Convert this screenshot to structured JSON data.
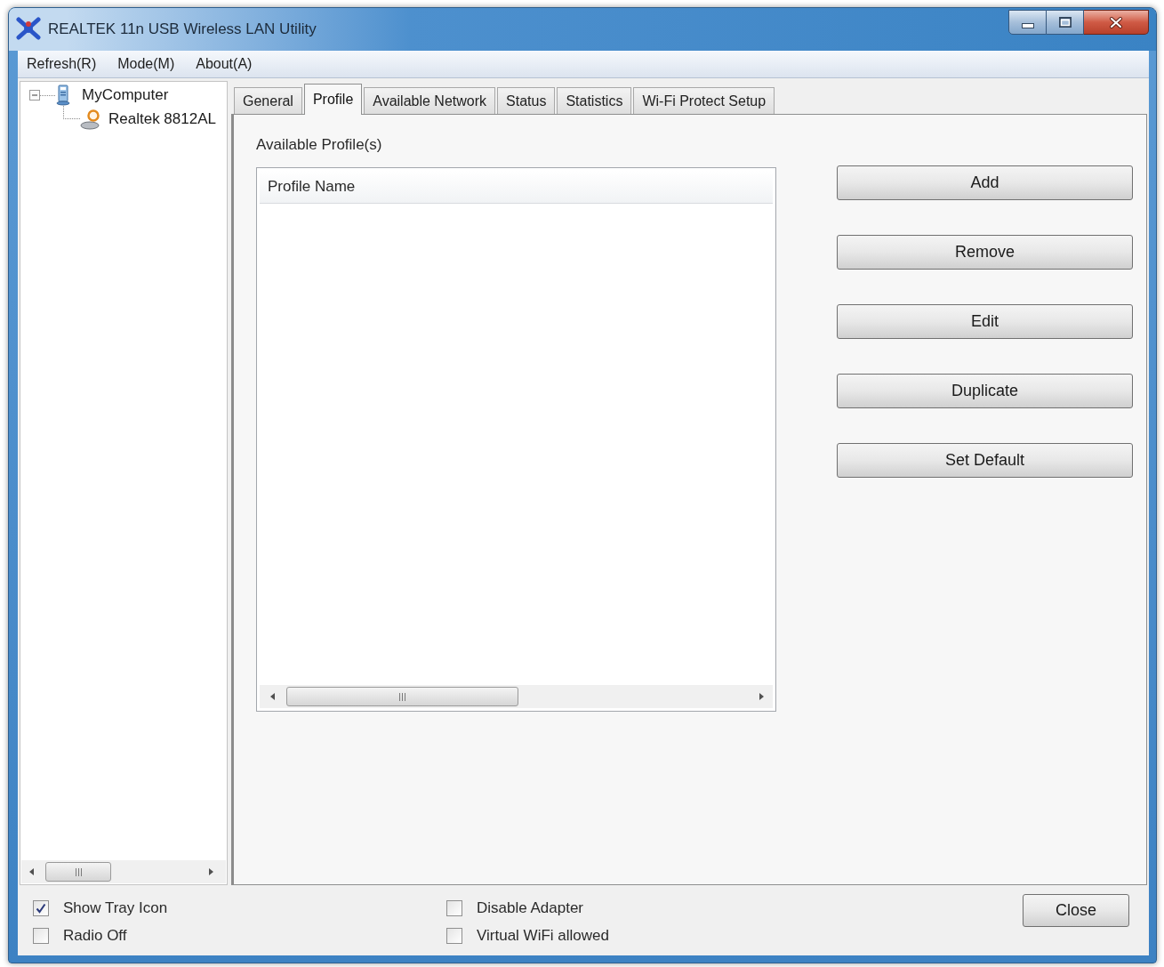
{
  "window": {
    "title": "REALTEK 11n USB Wireless LAN Utility"
  },
  "menu_bar": [
    {
      "label": "Refresh(R)"
    },
    {
      "label": "Mode(M)"
    },
    {
      "label": "About(A)"
    }
  ],
  "tree": [
    {
      "label": "MyComputer",
      "kind": "computer",
      "expanded": true,
      "children": [
        {
          "label": "Realtek 8812AL",
          "kind": "adapter"
        }
      ]
    }
  ],
  "tabs": [
    {
      "label": "General",
      "selected": false
    },
    {
      "label": "Profile",
      "selected": true
    },
    {
      "label": "Available Network",
      "selected": false
    },
    {
      "label": "Status",
      "selected": false
    },
    {
      "label": "Statistics",
      "selected": false
    },
    {
      "label": "Wi-Fi Protect Setup",
      "selected": false
    }
  ],
  "profile_tab": {
    "heading": "Available Profile(s)",
    "profile_list": {
      "columns": [
        "Profile Name"
      ]
    },
    "buttons": [
      "Add",
      "Remove",
      "Edit",
      "Duplicate",
      "Set Default"
    ]
  },
  "options": [
    {
      "label": "Show Tray Icon",
      "checked": true
    },
    {
      "label": "Radio Off",
      "checked": false
    },
    {
      "label": "Disable Adapter",
      "checked": false
    },
    {
      "label": "Virtual WiFi allowed",
      "checked": false
    }
  ],
  "close_button": "Close"
}
